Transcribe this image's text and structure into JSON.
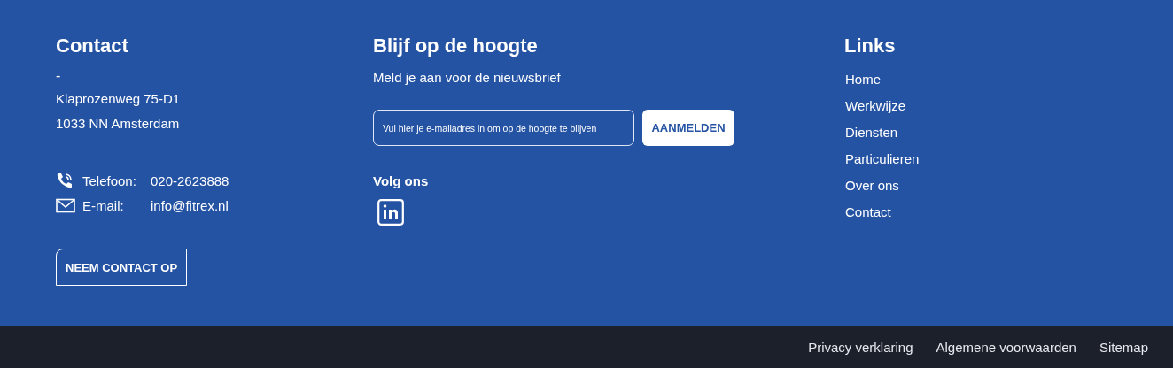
{
  "contact": {
    "heading": "Contact",
    "dash": "-",
    "address": [
      "Klaprozenweg 75-D1",
      "1033 NN Amsterdam"
    ],
    "details": [
      {
        "kind": "phone",
        "label": "Telefoon:",
        "value": "020-2623888"
      },
      {
        "kind": "email",
        "label": "E-mail:",
        "value": "info@fitrex.nl"
      }
    ],
    "button": "NEEM CONTACT OP"
  },
  "newsletter": {
    "heading": "Blijf op de hoogte",
    "text": "Meld je aan voor de nieuwsbrief",
    "email_field": {
      "placeholder": "Vul hier je e-mailadres in om op de hoogte te blijven"
    },
    "button": "AANMELDEN",
    "follow_heading": "Volg ons",
    "socials": [
      {
        "kind": "linkedin"
      }
    ]
  },
  "links": {
    "heading": "Links",
    "items": [
      "Home",
      "Werkwijze",
      "Diensten",
      "Particulieren",
      "Over ons",
      "Contact"
    ]
  },
  "bottom_bar": {
    "links": [
      "Privacy verklaring",
      "Algemene voorwaarden",
      "Sitemap"
    ]
  }
}
